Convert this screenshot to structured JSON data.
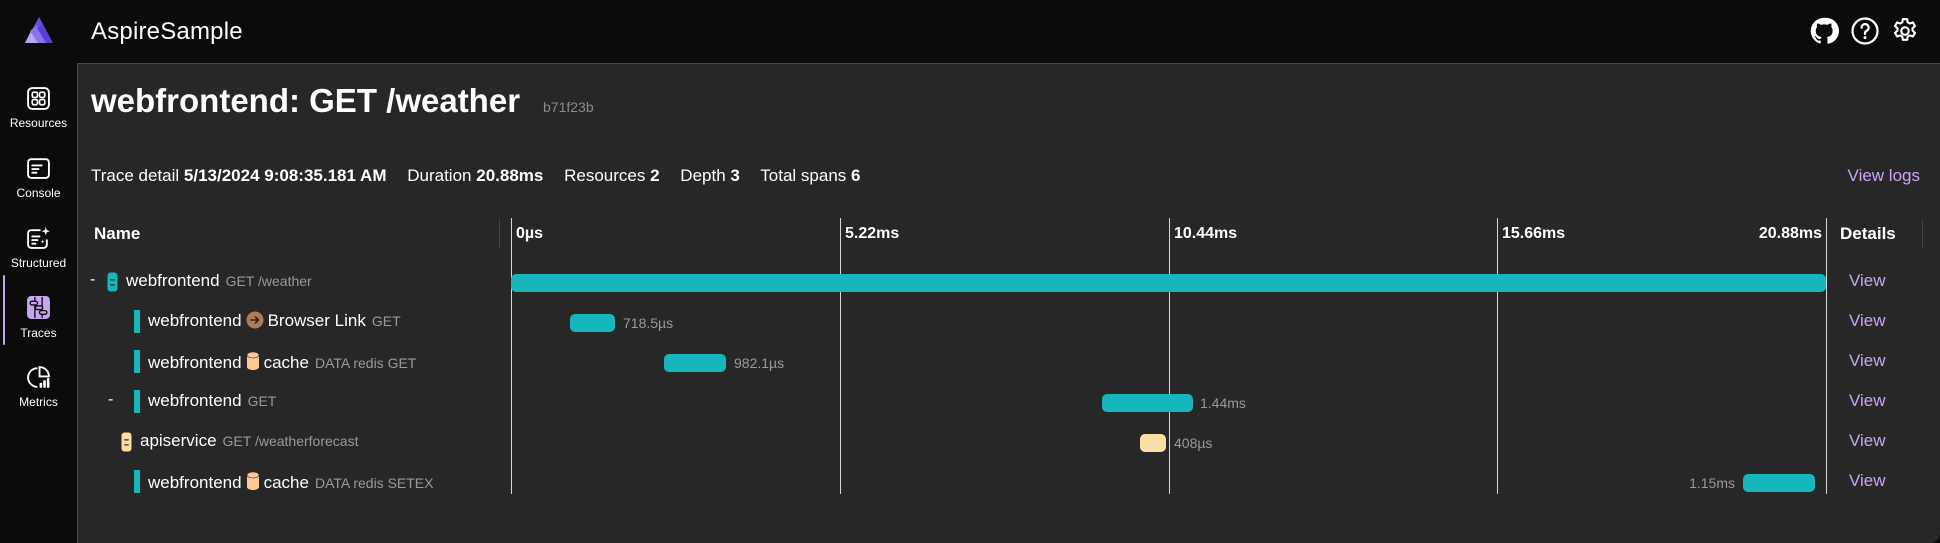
{
  "app": {
    "title": "AspireSample",
    "header_icons": [
      "github-icon",
      "help-icon",
      "settings-icon"
    ]
  },
  "sidebar": {
    "items": [
      {
        "label": "Resources",
        "icon": "resources-icon",
        "active": false
      },
      {
        "label": "Console",
        "icon": "console-icon",
        "active": false
      },
      {
        "label": "Structured",
        "icon": "structured-logs-icon",
        "active": false
      },
      {
        "label": "Traces",
        "icon": "traces-icon",
        "active": true
      },
      {
        "label": "Metrics",
        "icon": "metrics-icon",
        "active": false
      }
    ]
  },
  "page": {
    "title": "webfrontend: GET /weather",
    "trace_id": "b71f23b",
    "summary": {
      "trace_detail_label": "Trace detail",
      "trace_detail_value": "5/13/2024 9:08:35.181 AM",
      "duration_label": "Duration",
      "duration_value": "20.88ms",
      "resources_label": "Resources",
      "resources_value": "2",
      "depth_label": "Depth",
      "depth_value": "3",
      "total_spans_label": "Total spans",
      "total_spans_value": "6"
    },
    "view_logs_label": "View logs"
  },
  "table": {
    "headers": {
      "name": "Name",
      "details": "Details"
    },
    "ticks": [
      "0µs",
      "5.22ms",
      "10.44ms",
      "15.66ms",
      "20.88ms"
    ],
    "total_ms": 20.88,
    "view_label": "View",
    "colors": {
      "webfrontend": "#17b6bd",
      "apiservice": "#f9dea5",
      "browser_link_icon": "#b17b51",
      "cache_icon": "#fbc896"
    },
    "rows": [
      {
        "collapse": "-",
        "depth": 0,
        "service": "webfrontend",
        "icon": "service-icon",
        "peer": "",
        "peer_icon": "",
        "operation": "GET /weather",
        "start_ms": 0,
        "duration_ms": 20.88,
        "duration_label": "",
        "color": "#17b6bd"
      },
      {
        "collapse": "",
        "depth": 1,
        "service": "webfrontend",
        "icon": "",
        "peer": "Browser Link",
        "peer_icon": "browser-link-icon",
        "operation": "GET",
        "start_ms": 0.94,
        "duration_ms": 0.7185,
        "duration_label": "718.5µs",
        "color": "#17b6bd"
      },
      {
        "collapse": "",
        "depth": 1,
        "service": "webfrontend",
        "icon": "",
        "peer": "cache",
        "peer_icon": "database-icon",
        "operation": "DATA redis GET",
        "start_ms": 2.43,
        "duration_ms": 0.9821,
        "duration_label": "982.1µs",
        "color": "#17b6bd"
      },
      {
        "collapse": "-",
        "depth": 1,
        "service": "webfrontend",
        "icon": "",
        "peer": "",
        "peer_icon": "",
        "operation": "GET",
        "start_ms": 9.38,
        "duration_ms": 1.44,
        "duration_label": "1.44ms",
        "color": "#17b6bd"
      },
      {
        "collapse": "",
        "depth": 2,
        "service": "apiservice",
        "icon": "service-icon",
        "peer": "",
        "peer_icon": "",
        "operation": "GET /weatherforecast",
        "start_ms": 9.99,
        "duration_ms": 0.408,
        "duration_label": "408µs",
        "color": "#f9dea5"
      },
      {
        "collapse": "",
        "depth": 1,
        "service": "webfrontend",
        "icon": "",
        "peer": "cache",
        "peer_icon": "database-icon",
        "operation": "DATA redis SETEX",
        "start_ms": 19.56,
        "duration_ms": 1.15,
        "duration_label": "1.15ms",
        "color": "#17b6bd",
        "label_left": true
      }
    ]
  }
}
